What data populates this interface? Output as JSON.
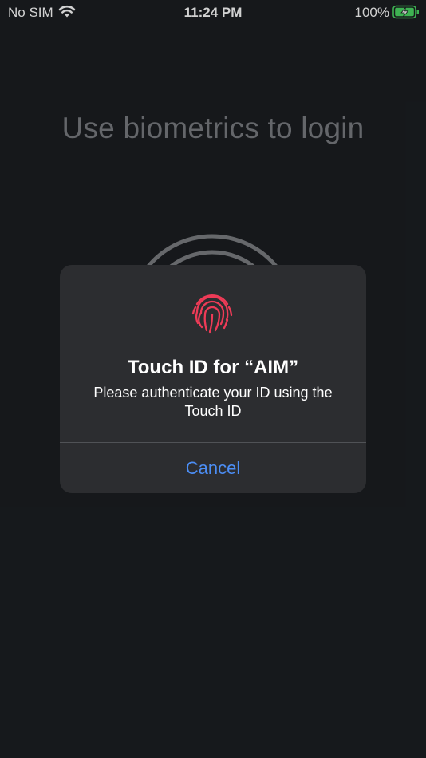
{
  "status_bar": {
    "carrier": "No SIM",
    "time": "11:24 PM",
    "battery_percent": "100%",
    "battery_color": "#4cd964"
  },
  "page": {
    "title": "Use biometrics to login"
  },
  "dialog": {
    "icon": "fingerprint-icon",
    "icon_color": "#ee3b57",
    "title": "Touch ID for “AIM”",
    "message": "Please authenticate your ID using the Touch ID",
    "cancel_label": "Cancel",
    "cancel_color": "#4c8ef5"
  }
}
